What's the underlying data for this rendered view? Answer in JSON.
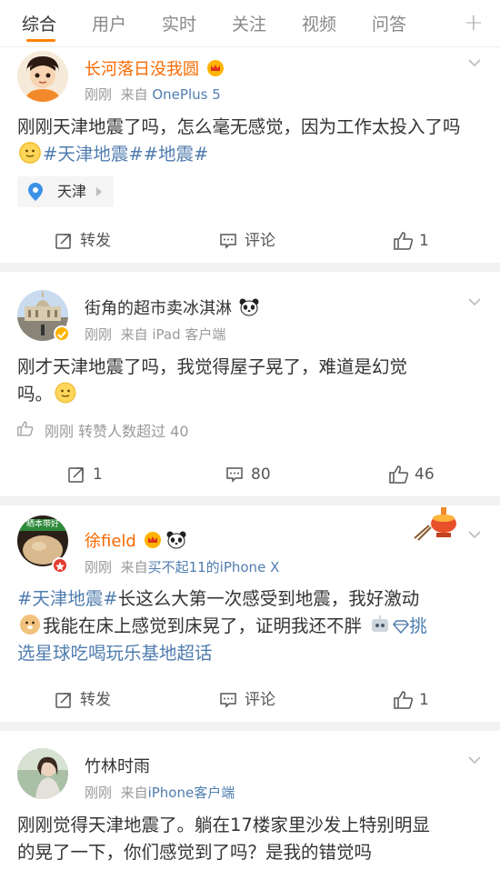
{
  "tabs": [
    "综合",
    "用户",
    "实时",
    "关注",
    "视频",
    "问答"
  ],
  "posts": [
    {
      "username": "长河落日没我圆",
      "time": "刚刚",
      "source_prefix": "来自",
      "source": "OnePlus 5",
      "text_main": "刚刚天津地震了吗，怎么毫无感觉，因为工作太投入了吗",
      "tag1": "#天津地震#",
      "tag2": "#地震#",
      "location": "天津",
      "repost": "转发",
      "comment": "评论",
      "like": "1"
    },
    {
      "username": "街角的超市卖冰淇淋",
      "time": "刚刚",
      "source_prefix": "来自",
      "source": "iPad 客户端",
      "text_line1": "刚才天津地震了吗，我觉得屋子晃了，难道是幻觉",
      "text_line2": "吗。",
      "liked_info": "刚刚 转赞人数超过 40",
      "repost": "1",
      "comment": "80",
      "like": "46"
    },
    {
      "username": "徐field",
      "time": "刚刚",
      "source_prefix": "来自",
      "source": "买不起11的iPhone X",
      "tag": "#天津地震#",
      "text_line1": "长这么大第一次感受到地震，我好激动",
      "text_line2": "我能在床上感觉到床晃了，证明我还不胖",
      "super_link_line1": "挑",
      "super_link_line2": "选星球吃喝玩乐基地超话",
      "avatar_text": "晒本带好",
      "repost": "转发",
      "comment": "评论",
      "like": "1"
    },
    {
      "username": "竹林时雨",
      "time": "刚刚",
      "source_prefix": "来自",
      "source": "iPhone客户端",
      "text_line1": "刚刚觉得天津地震了。躺在17楼家里沙发上特别明显",
      "text_line2": "的晃了一下，你们感觉到了吗？是我的错觉吗"
    }
  ],
  "colors": {
    "accent": "#ff8200",
    "link": "#507daf",
    "vip_name": "#f86a00",
    "muted": "#999999",
    "separator": "#f2f2f2"
  },
  "icons": [
    "chevron-down-icon",
    "location-pin-icon",
    "repost-icon",
    "comment-icon",
    "like-icon",
    "panda-icon",
    "vip-crown-icon",
    "smile-emoji-icon",
    "doge-emoji-icon",
    "robot-emoji-icon",
    "diamond-icon",
    "verified-badge-icon"
  ]
}
